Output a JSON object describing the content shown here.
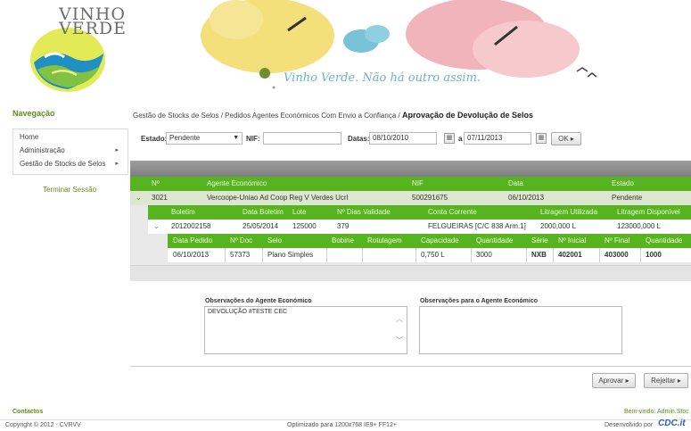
{
  "brand": {
    "logo_text_line1": "VINHO",
    "logo_text_line2": "VERDE",
    "slogan": "Vinho Verde. Não há outro assim."
  },
  "nav": {
    "title": "Navegação",
    "items": [
      {
        "label": "Home",
        "has_submenu": false
      },
      {
        "label": "Administração",
        "has_submenu": true
      },
      {
        "label": "Gestão de Stocks de Selos",
        "has_submenu": true
      }
    ],
    "logout": "Terminar Sessão"
  },
  "breadcrumb": {
    "path": "Gestão de Stocks de Selos  /  Pedidos Agentes Económicos Com Envio a Confiança  /",
    "current": "Aprovação de Devolução de Selos"
  },
  "filters": {
    "estado_label": "Estado:",
    "estado_value": "Pendente",
    "nif_label": "NIF:",
    "nif_value": "",
    "datas_label": "Datas:",
    "date_from": "08/10/2010",
    "date_to_label": "a",
    "date_to": "07/11/2013",
    "ok_label": "OK ▸"
  },
  "grid": {
    "headers": [
      "Nº",
      "Agente Económico",
      "NIF",
      "Data",
      "Estado"
    ],
    "row": {
      "num": "3021",
      "agente": "Vercoope-Uniao Ad Coop Reg V Verdes Ucrl",
      "nif": "500291675",
      "data": "06/10/2013",
      "estado": "Pendente"
    },
    "sub_headers": [
      "Boletim",
      "Data Boletim",
      "Lote",
      "Nº Dias Validade",
      "Conta Corrente",
      "Litragem Utilizada",
      "Litragem Disponível"
    ],
    "sub_row": {
      "boletim": "2012002158",
      "data_boletim": "25/05/2014",
      "lote": "125000",
      "dias": "379",
      "conta": "FELGUEIRAS [C/C 838 Arm.1]",
      "lit_util": "2000,000 L",
      "lit_disp": "123000,000 L"
    },
    "detail_headers": [
      "Data Pedido",
      "Nº Doc",
      "Selo",
      "Bobine",
      "Rotulagem",
      "Capacidade",
      "Quantidade",
      "Série",
      "Nº Inicial",
      "Nº Final",
      "Quantidade"
    ],
    "detail_row": {
      "data_pedido": "06/10/2013",
      "num_doc": "57373",
      "selo": "Plano Simples",
      "bobine": "",
      "rotulagem": "",
      "capacidade": "0,750 L",
      "quantidade": "3000",
      "serie": "NXB",
      "inicial": "402001",
      "final": "403000",
      "quantidade2": "1000"
    }
  },
  "observations": {
    "agent_label": "Observações do Agente Económico",
    "agent_text": "DEVOLUÇÃO #TESTE CEC",
    "to_agent_label": "Observações para o Agente Económico",
    "to_agent_text": ""
  },
  "actions": {
    "approve": "Aprovar ▸",
    "reject": "Rejeitar ▸"
  },
  "footer": {
    "contacts": "Contactos",
    "welcome": "Bem-vindo: Admin.Stoc",
    "copyright": "Copyright © 2012 - CVRVV",
    "optimized": "Optimizado para 1200x768 IE9+ FF12+",
    "developed_by": "Desenvolvido por",
    "developer": "CDC.it"
  },
  "colors": {
    "green_header": "#57b31f",
    "nav_green": "#5d8f1a",
    "slogan_blue": "#6cb2c9"
  }
}
